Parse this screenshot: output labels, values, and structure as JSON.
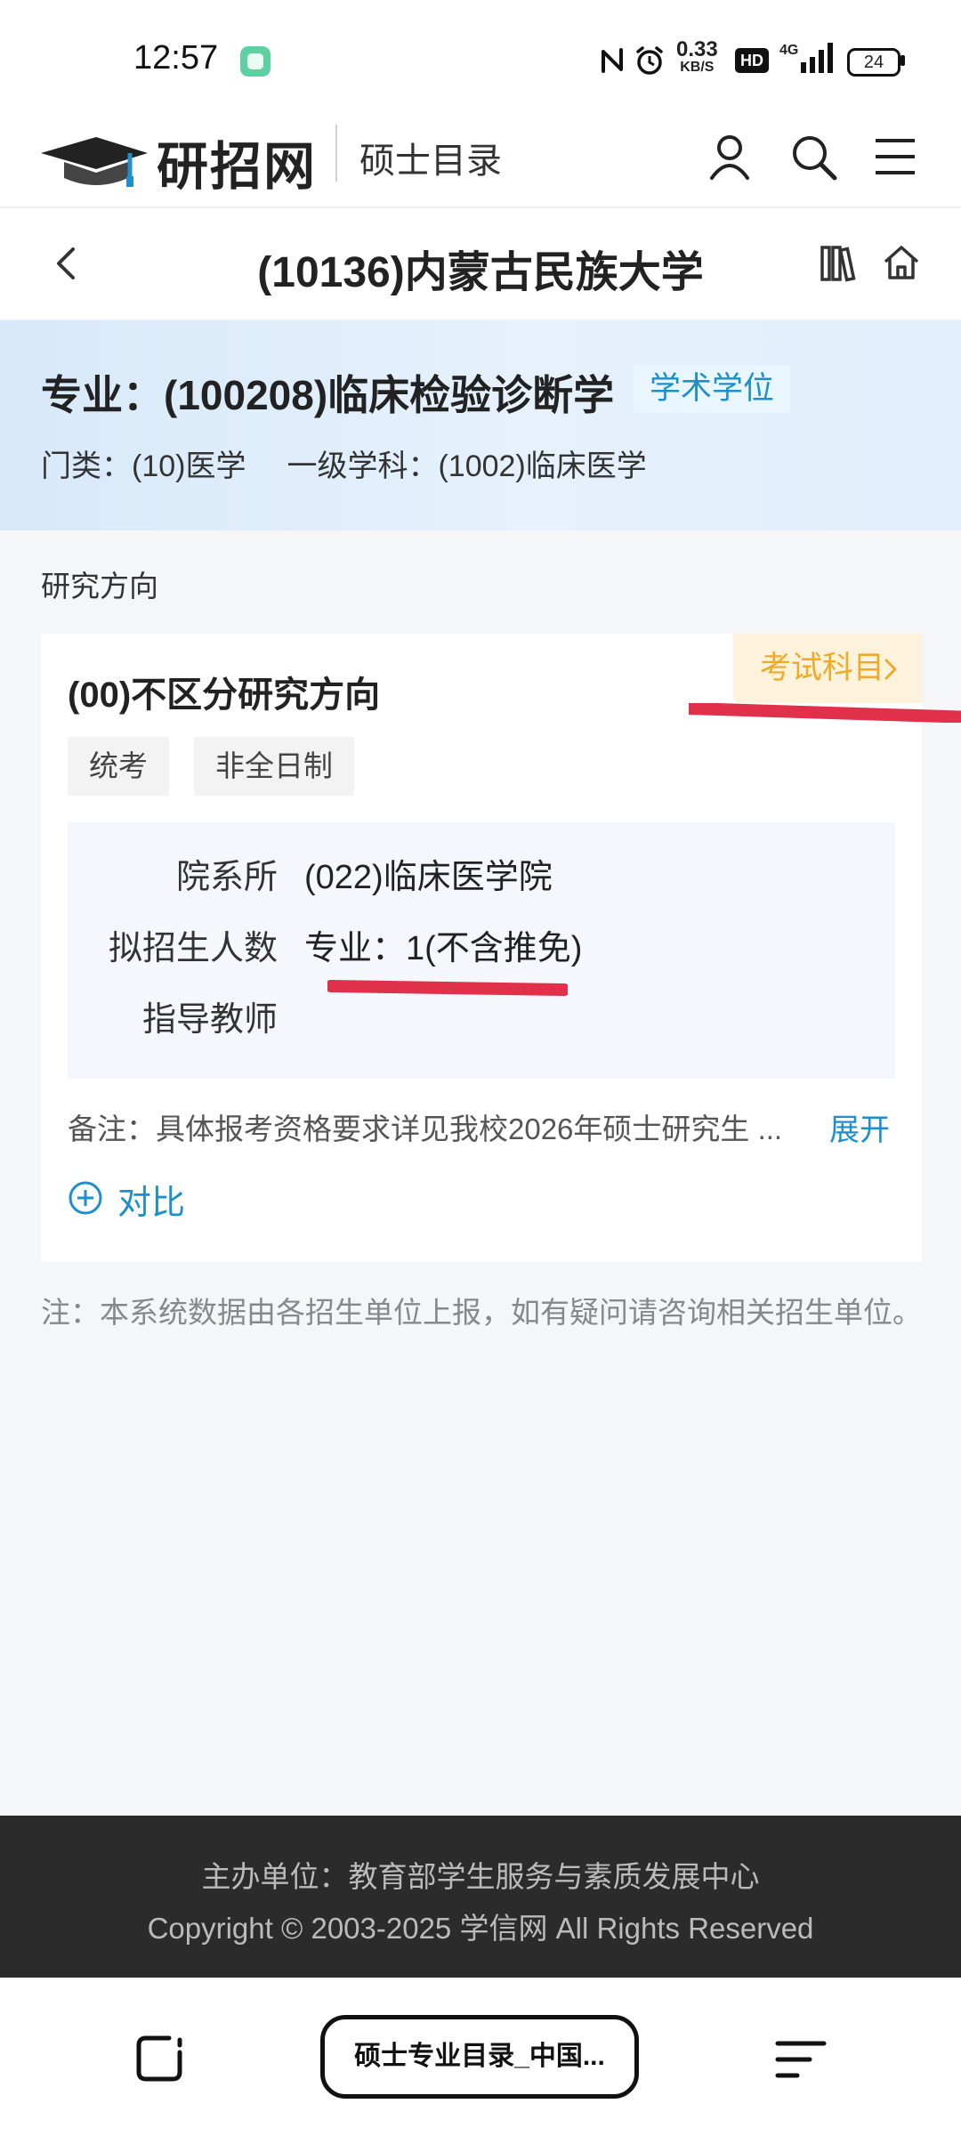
{
  "status_bar": {
    "time": "12:57",
    "net_speed_value": "0.33",
    "net_speed_unit": "KB/S",
    "hd_label": "HD",
    "signal_label": "4G",
    "battery": "24"
  },
  "header": {
    "logo_text": "研招网",
    "subtitle": "硕士目录"
  },
  "title_bar": {
    "school": "(10136)内蒙古民族大学"
  },
  "major": {
    "title": "专业：(100208)临床检验诊断学",
    "degree_type": "学术学位",
    "category": "门类：(10)医学",
    "discipline": "一级学科：(1002)临床医学"
  },
  "section_label": "研究方向",
  "direction": {
    "title": "(00)不区分研究方向",
    "exam_subjects_button": "考试科目",
    "tags": [
      "统考",
      "非全日制"
    ],
    "info": [
      {
        "label": "院系所",
        "value": "(022)临床医学院"
      },
      {
        "label": "拟招生人数",
        "value": "专业：1(不含推免)"
      },
      {
        "label": "指导教师",
        "value": ""
      }
    ],
    "remark": "备注：具体报考资格要求详见我校2026年硕士研究生 ...",
    "expand_label": "展开",
    "compare_label": "对比"
  },
  "note": "注：本系统数据由各招生单位上报，如有疑问请咨询相关招生单位。",
  "footer": {
    "organizer": "主办单位：教育部学生服务与素质发展中心",
    "copyright": "Copyright © 2003-2025 学信网 All Rights Reserved"
  },
  "nav_bar": {
    "tab_title": "硕士专业目录_中国..."
  },
  "colors": {
    "accent_blue": "#1d8fcb",
    "exam_orange": "#efaa28",
    "annotation_red": "#e0304a"
  },
  "icons": [
    "back-icon",
    "books-icon",
    "home-icon",
    "user-icon",
    "search-icon",
    "menu-icon",
    "plus-circle-icon",
    "chevron-right-icon"
  ]
}
